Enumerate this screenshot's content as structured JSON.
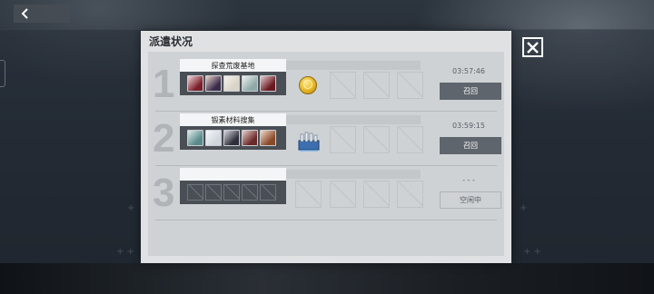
{
  "modal": {
    "title": "派遣状况"
  },
  "rows": [
    {
      "number": "1",
      "mission": "探查荒废基地",
      "timer": "03:57:46",
      "button": "召回",
      "characters": [
        "#7a1f2a",
        "#3a2b4a",
        "#d9d3c8",
        "#8fa8a8",
        "#6a1a22"
      ],
      "reward": "coin-icon"
    },
    {
      "number": "2",
      "mission": "锻素材料搜集",
      "timer": "03:59:15",
      "button": "召回",
      "characters": [
        "#5a8a8a",
        "#cfd6dc",
        "#2e2f3a",
        "#6a2a2a",
        "#8a4a2a"
      ],
      "reward": "ammo-crate-icon"
    },
    {
      "number": "3",
      "mission": "",
      "timer": "- - -",
      "button": "空闲中",
      "characters": [],
      "reward": ""
    }
  ],
  "colors": {
    "modal_bg": "#dfe1e3",
    "recall_button": "#5f656c",
    "team_box": "#4a4f56"
  }
}
